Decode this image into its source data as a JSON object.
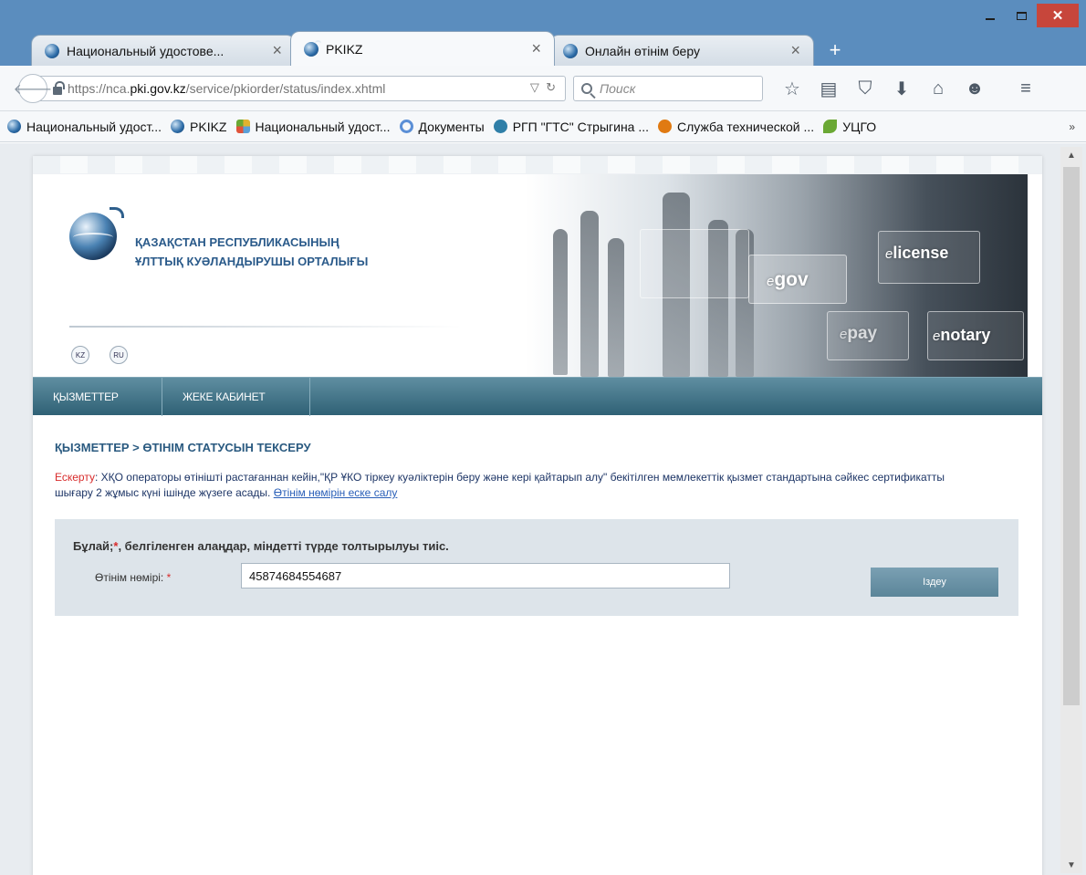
{
  "browser": {
    "tabs": [
      {
        "label": "Национальный удостове..."
      },
      {
        "label": "PKIKZ"
      },
      {
        "label": "Онлайн өтінім беру"
      }
    ],
    "url": {
      "scheme": "https://nca.",
      "host": "pki.gov.kz",
      "path": "/service/pkiorder/status/index.xhtml"
    },
    "search_placeholder": "Поиск",
    "bookmarks": [
      {
        "label": "Национальный удост...",
        "color": "#2a6aa6"
      },
      {
        "label": "PKIKZ",
        "color": "#2a6aa6"
      },
      {
        "label": "Национальный удост...",
        "color": "#e0b22f"
      },
      {
        "label": "Документы",
        "color": "#5b8fd6"
      },
      {
        "label": "РГП \"ГТС\" Стрыгина ...",
        "color": "#2f7fa8"
      },
      {
        "label": "Служба технической ...",
        "color": "#e07a12"
      },
      {
        "label": "УЦГО",
        "color": "#6aa834"
      }
    ]
  },
  "site": {
    "org_name_line1": "ҚАЗАҚСТАН РЕСПУБЛИКАСЫНЫҢ",
    "org_name_line2": "ҰЛТТЫҚ КУӘЛАНДЫРУШЫ ОРТАЛЫҒЫ",
    "languages": [
      "KZ",
      "RU"
    ],
    "banner": {
      "e_prefix": "e",
      "gov": "gov",
      "license": "license",
      "pay": "pay",
      "notary": "notary"
    },
    "nav": [
      "ҚЫЗМЕТТЕР",
      "ЖЕКЕ КАБИНЕТ"
    ]
  },
  "main": {
    "breadcrumb": "ҚЫЗМЕТТЕР > ӨТІНІМ СТАТУСЫН ТЕКСЕРУ",
    "notice_warn": "Ескерту",
    "notice_text": ": ХҚО операторы өтінішті растағаннан кейін,\"ҚР ҰКО тіркеу куәліктерін беру және кері қайтарып алу\" бекітілген мемлекеттік қызмет стандартына сәйкес сертификатты шығару 2 жұмыс күні ішінде жүзеге асады. ",
    "notice_link": "Өтінім нөмірін еске салу",
    "form": {
      "note_prefix": "Бұлай;",
      "required_mark": "*",
      "note_suffix": ", белгіленген алаңдар, міндетті түрде толтырылуы тиіс.",
      "field_label": "Өтінім нөмірі: ",
      "field_value": "45874684554687",
      "button_label": "Іздеу"
    }
  },
  "colors": {
    "accent_blue": "#2a5a8a",
    "nav_bar": "#3d7086",
    "warning_red": "#d82b2b",
    "chrome_blue": "#5b8dbe"
  }
}
